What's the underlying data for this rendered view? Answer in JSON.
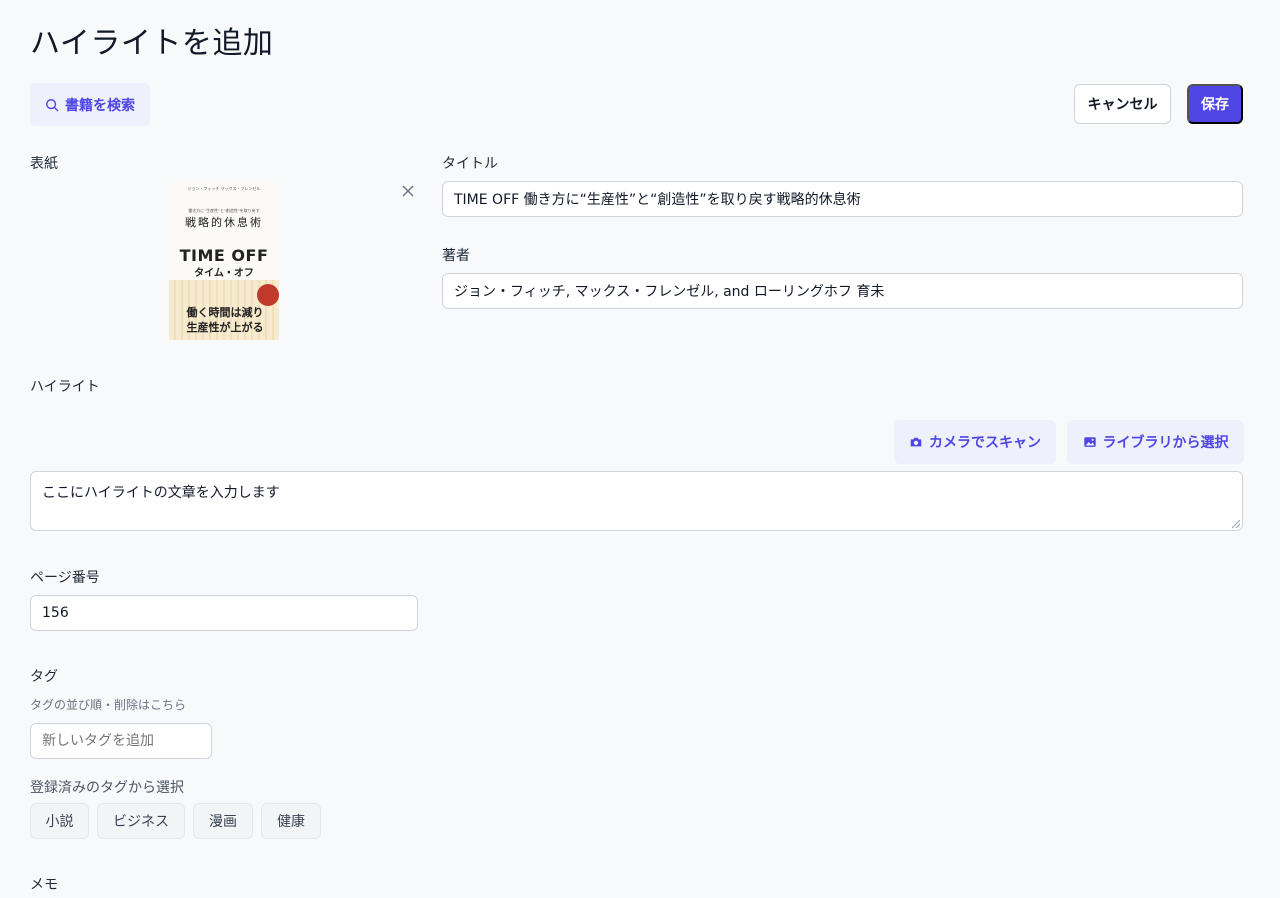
{
  "page": {
    "title": "ハイライトを追加"
  },
  "toolbar": {
    "search_book_label": "書籍を検索",
    "cancel_label": "キャンセル",
    "save_label": "保存"
  },
  "cover": {
    "label": "表紙",
    "image_text": {
      "top_line": "ジョン・フィッチ マックス・フレンゼル",
      "small_line": "働き方に\"生産性\"と\"創造性\"を取り戻す",
      "subtitle": "戦略的休息術",
      "title": "TIME OFF",
      "title_kana": "タイム・オフ",
      "catch_1": "働く時間は減り",
      "catch_2": "生産性が上がる"
    }
  },
  "title_field": {
    "label": "タイトル",
    "value": "TIME OFF 働き方に“生産性”と“創造性”を取り戻す戦略的休息術"
  },
  "author_field": {
    "label": "著者",
    "value": "ジョン・フィッチ, マックス・フレンゼル, and ローリングホフ 育未"
  },
  "highlight": {
    "label": "ハイライト",
    "camera_label": "カメラでスキャン",
    "library_label": "ライブラリから選択",
    "text": "ここにハイライトの文章を入力します"
  },
  "page_number": {
    "label": "ページ番号",
    "value": "156"
  },
  "tags": {
    "label": "タグ",
    "manage_hint": "タグの並び順・削除はこちら",
    "new_tag_placeholder": "新しいタグを追加",
    "registered_label": "登録済みのタグから選択",
    "items": [
      "小説",
      "ビジネス",
      "漫画",
      "健康"
    ]
  },
  "memo": {
    "label": "メモ"
  },
  "colors": {
    "accent": "#4f46e5",
    "accent_soft": "#eef0fc",
    "background": "#f8f9fb"
  }
}
